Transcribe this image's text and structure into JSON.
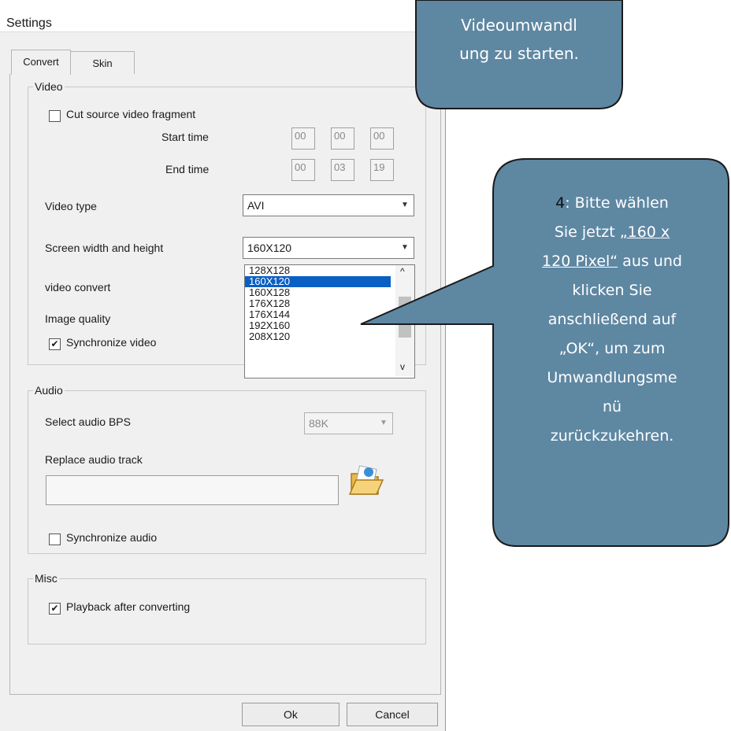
{
  "window": {
    "title": "Settings"
  },
  "tabs": [
    {
      "label": "Convert"
    },
    {
      "label": "Skin"
    }
  ],
  "video": {
    "legend": "Video",
    "cut_label": "Cut source video fragment",
    "start_label": "Start time",
    "start": [
      "00",
      "00",
      "00"
    ],
    "end_label": "End time",
    "end": [
      "00",
      "03",
      "19"
    ],
    "type_label": "Video type",
    "type_value": "AVI",
    "size_label": "Screen width and height",
    "size_value": "160X120",
    "convert_label": "video convert",
    "quality_label": "Image quality",
    "sync_label": "Synchronize video",
    "sync_checked": "✔",
    "size_options": [
      "128X128",
      "160X120",
      "160X128",
      "176X128",
      "176X144",
      "192X160",
      "208X120"
    ],
    "size_selected_index": 1
  },
  "audio": {
    "legend": "Audio",
    "bps_label": "Select audio BPS",
    "bps_value": "88K",
    "replace_label": "Replace audio track",
    "replace_value": "",
    "sync_label": "Synchronize audio"
  },
  "misc": {
    "legend": "Misc",
    "playback_label": "Playback after converting",
    "playback_checked": "✔"
  },
  "buttons": {
    "ok": "Ok",
    "cancel": "Cancel"
  },
  "callout_top": {
    "lines": [
      "Videoumwandl",
      "ung zu starten."
    ]
  },
  "callout_main": {
    "step": "4",
    "line1_rest": ": Bitte wählen",
    "line2_plain": "Sie jetzt ",
    "line2_underlined": "„160 x",
    "line3_underlined": "120 Pixel“",
    "line3_plain": " aus und",
    "line4": "klicken Sie",
    "line5": "anschließend auf",
    "line6": "„OK“, um zum",
    "line7": "Umwandlungsme",
    "line8": "nü",
    "line9": "zurückzukehren."
  },
  "colors": {
    "callout_fill": "#5e87a2",
    "callout_border": "#1a1a1a",
    "selection": "#0a5fc4",
    "step_number": "#111111"
  }
}
